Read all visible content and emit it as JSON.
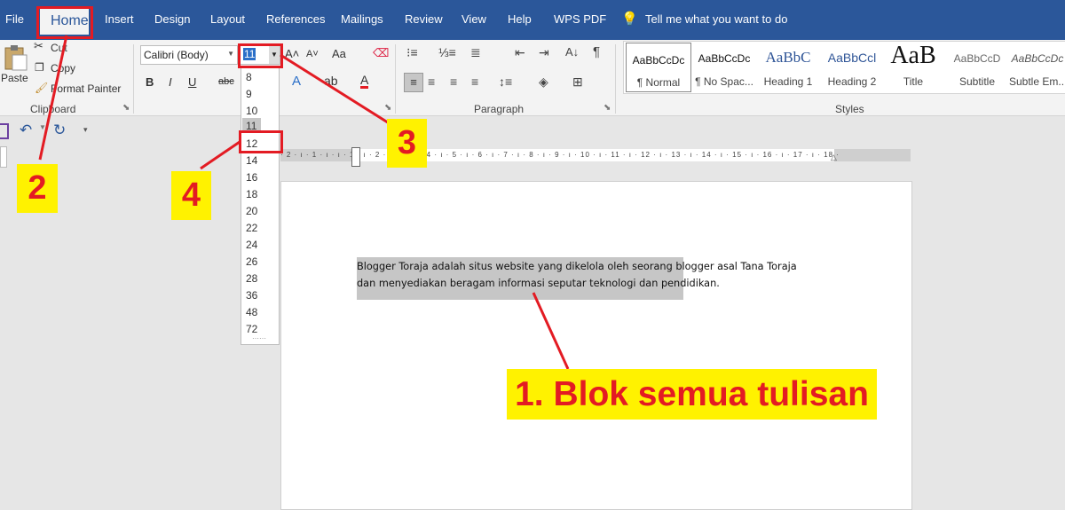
{
  "ribbon_tabs": [
    "File",
    "Home",
    "Insert",
    "Design",
    "Layout",
    "References",
    "Mailings",
    "Review",
    "View",
    "Help",
    "WPS PDF"
  ],
  "tell_me": "Tell me what you want to do",
  "clipboard": {
    "paste": "Paste",
    "cut": "Cut",
    "copy": "Copy",
    "format_painter": "Format Painter",
    "group_label": "Clipboard"
  },
  "font": {
    "name": "Calibri (Body)",
    "size": "11",
    "bold": "B",
    "italic": "I",
    "underline": "U",
    "strike": "abc",
    "change_case": "Aa",
    "font_color": "A"
  },
  "paragraph": {
    "group_label": "Paragraph",
    "pilcrow": "¶"
  },
  "styles": {
    "group_label": "Styles",
    "items": [
      {
        "preview": "AaBbCcDc",
        "name": "¶ Normal"
      },
      {
        "preview": "AaBbCcDc",
        "name": "¶ No Spac..."
      },
      {
        "preview": "AaBbC",
        "name": "Heading 1"
      },
      {
        "preview": "AaBbCcl",
        "name": "Heading 2"
      },
      {
        "preview": "AaB",
        "name": "Title"
      },
      {
        "preview": "AaBbCcD",
        "name": "Subtitle"
      },
      {
        "preview": "AaBbCcDc",
        "name": "Subtle Em..."
      }
    ]
  },
  "font_sizes": [
    "8",
    "9",
    "10",
    "11",
    "12",
    "14",
    "16",
    "18",
    "20",
    "22",
    "24",
    "26",
    "28",
    "36",
    "48",
    "72"
  ],
  "ruler_text": "· 2 · ı · 1 · ı · ı · 1 · ı · 2 · ı · 3 · ı · 4 · ı · 5 · ı · 6 · ı · 7 · ı · 8 · ı · 9 · ı · 10 · ı · 11 · ı · 12 · ı · 13 · ı · 14 · ı · 15 · ı · 16 · ı · 17 · ı · 18 ·",
  "document_text": "Blogger Toraja adalah situs website yang dikelola oleh seorang blogger asal Tana Toraja dan menyediakan beragam informasi seputar teknologi dan pendidikan.",
  "annotations": {
    "step1": "1. Blok semua tulisan",
    "step2": "2",
    "step3": "3",
    "step4": "4"
  },
  "colors": {
    "ribbon_blue": "#2b579a",
    "annotation_red": "#e31b23",
    "annotation_yellow": "#fff200"
  }
}
